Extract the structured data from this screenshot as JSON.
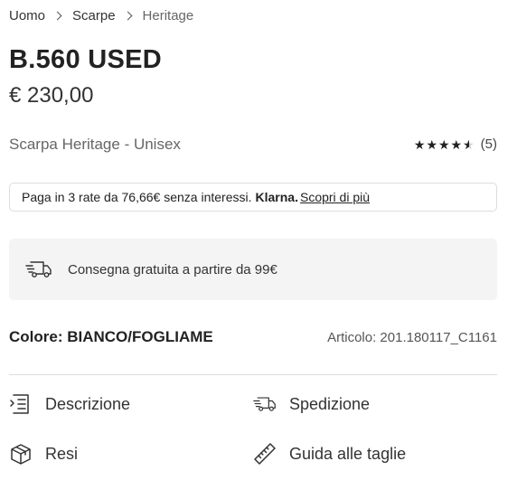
{
  "breadcrumb": {
    "items": [
      "Uomo",
      "Scarpe",
      "Heritage"
    ]
  },
  "product": {
    "title": "B.560 USED",
    "price": "€ 230,00",
    "subtitle": "Scarpa Heritage - Unisex",
    "rating": {
      "value": 4.5,
      "max": 5,
      "count_label": "(5)"
    }
  },
  "klarna": {
    "text": "Paga in 3 rate da 76,66€ senza interessi.",
    "brand": "Klarna.",
    "link": "Scopri di più"
  },
  "shipping_banner": {
    "icon": "fast-delivery-truck-icon",
    "text": "Consegna gratuita a partire da 99€"
  },
  "details": {
    "color_label": "Colore: BIANCO/FOGLIAME",
    "article": "Articolo: 201.180117_C1161"
  },
  "info_links": {
    "description": {
      "label": "Descrizione",
      "icon": "list-document-icon"
    },
    "shipping": {
      "label": "Spedizione",
      "icon": "fast-delivery-truck-icon"
    },
    "returns": {
      "label": "Resi",
      "icon": "box-icon"
    },
    "size_guide": {
      "label": "Guida alle taglie",
      "icon": "ruler-icon"
    }
  }
}
